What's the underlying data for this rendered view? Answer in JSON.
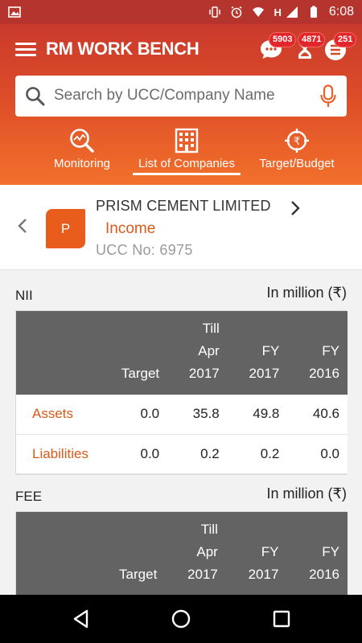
{
  "status_bar": {
    "time": "6:08",
    "network": "H",
    "icons": [
      "gallery-icon",
      "vibrate-icon",
      "alarm-icon",
      "wifi-icon",
      "signal-icon",
      "battery-icon"
    ]
  },
  "app": {
    "title": "RM WORK BENCH",
    "badges": {
      "messages": "5903",
      "tasks": "4871",
      "lists": "251"
    }
  },
  "search": {
    "placeholder": "Search by UCC/Company Name"
  },
  "tabs": [
    {
      "label": "Monitoring",
      "icon": "monitoring-icon"
    },
    {
      "label": "List of Companies",
      "icon": "building-icon",
      "active": true
    },
    {
      "label": "Target/Budget",
      "icon": "rupee-target-icon"
    }
  ],
  "company": {
    "avatar_letter": "P",
    "name": "PRISM CEMENT LIMITED",
    "type": "Income",
    "ucc": "UCC No: 6975"
  },
  "sections": [
    {
      "title": "NII",
      "unit": "In million (₹)",
      "headers": [
        [
          "",
          "",
          ""
        ],
        [
          "",
          "",
          "Target"
        ],
        [
          "Till",
          "Apr",
          "2017"
        ],
        [
          "",
          "FY",
          "2017"
        ],
        [
          "",
          "FY",
          "2016"
        ]
      ],
      "rows": [
        {
          "label": "Assets",
          "values": [
            "0.0",
            "35.8",
            "49.8",
            "40.6"
          ]
        },
        {
          "label": "Liabilities",
          "values": [
            "0.0",
            "0.2",
            "0.2",
            "0.0"
          ]
        }
      ]
    },
    {
      "title": "FEE",
      "unit": "In million (₹)",
      "headers": [
        [
          "",
          "",
          ""
        ],
        [
          "",
          "",
          "Target"
        ],
        [
          "Till",
          "Apr",
          "2017"
        ],
        [
          "",
          "FY",
          "2017"
        ],
        [
          "",
          "FY",
          "2016"
        ]
      ]
    }
  ],
  "colors": {
    "header_top": "#c93a2c",
    "header_bottom": "#f2712b",
    "accent": "#d95a1b",
    "table_header": "#636363",
    "badge": "#e3262b"
  }
}
